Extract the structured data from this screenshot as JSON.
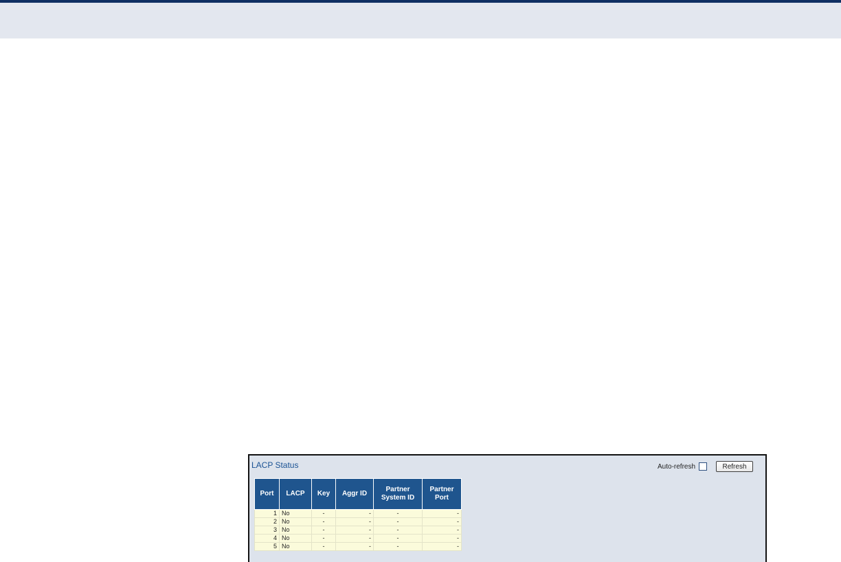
{
  "panel": {
    "title": "LACP Status",
    "auto_refresh_label": "Auto-refresh",
    "auto_refresh_checked": false,
    "refresh_button": "Refresh"
  },
  "table": {
    "headers": [
      "Port",
      "LACP",
      "Key",
      "Aggr ID",
      "Partner System ID",
      "Partner Port"
    ],
    "rows": [
      {
        "port": "1",
        "lacp": "No",
        "key": "-",
        "aggr_id": "-",
        "partner_system_id": "-",
        "partner_port": "-"
      },
      {
        "port": "2",
        "lacp": "No",
        "key": "-",
        "aggr_id": "-",
        "partner_system_id": "-",
        "partner_port": "-"
      },
      {
        "port": "3",
        "lacp": "No",
        "key": "-",
        "aggr_id": "-",
        "partner_system_id": "-",
        "partner_port": "-"
      },
      {
        "port": "4",
        "lacp": "No",
        "key": "-",
        "aggr_id": "-",
        "partner_system_id": "-",
        "partner_port": "-"
      },
      {
        "port": "5",
        "lacp": "No",
        "key": "-",
        "aggr_id": "-",
        "partner_system_id": "-",
        "partner_port": "-"
      }
    ]
  },
  "colors": {
    "header_rule": "#0f2f63",
    "header_band": "#e3e7ef",
    "panel_bg": "#dde3ec",
    "table_header": "#1f558e",
    "table_cell": "#fbfbdb",
    "title_text": "#1a5294"
  }
}
